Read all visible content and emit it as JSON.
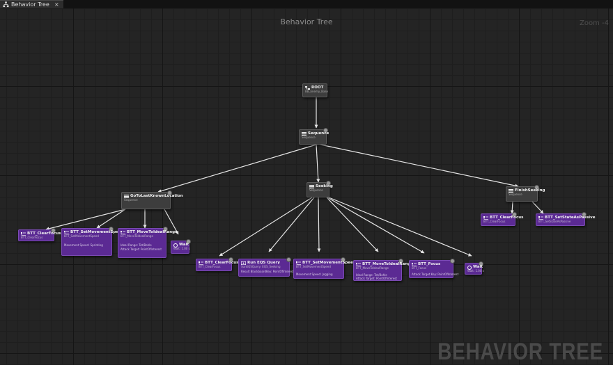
{
  "tab": {
    "label": "Behavior Tree",
    "close": "×"
  },
  "graph": {
    "title": "Behavior Tree",
    "zoom": "Zoom -4",
    "watermark": "BEHAVIOR TREE"
  },
  "nodes": {
    "root": {
      "title": "ROOT",
      "sub": "BB_Enemy_Base"
    },
    "seq": {
      "title": "Sequence",
      "sub": "Sequence"
    },
    "goto": {
      "title": "GoToLastKnownLocation",
      "sub": "Sequence"
    },
    "seeking": {
      "title": "Seeking",
      "sub": "Sequence"
    },
    "finish": {
      "title": "FinishSeeking",
      "sub": "Sequence"
    },
    "g_clear": {
      "title": "BTT_ClearFocus",
      "sub": "BTT_ClearFocus"
    },
    "g_speed": {
      "title": "BTT_SetMovementSpeed",
      "sub": "BTT_SetMovementSpeed",
      "p1": "Movement Speed: Sprinting"
    },
    "g_move": {
      "title": "BTT_MoveToIdealRange",
      "sub": "BTT_MoveToIdealRange",
      "p1": "Ideal Range: Tet/Bohle",
      "p2": "Attack Target: PointOfInterest"
    },
    "g_wait": {
      "title": "Wait",
      "sub": "Wait: 1.00 s"
    },
    "s_clear": {
      "title": "BTT_ClearFocus",
      "sub": "BTT_ClearFocus"
    },
    "s_eqs": {
      "title": "Run EQS Query",
      "sub": "SunEQSQuery: EQS_Seeking",
      "p1": "Result BlackboardKey: PointOfInterest"
    },
    "s_speed": {
      "title": "BTT_SetMovementSpeed",
      "sub": "BTT_SetMovementSpeed",
      "p1": "Movement Speed: Jogging"
    },
    "s_move": {
      "title": "BTT_MoveToIdealRange",
      "sub": "BTT_MoveToIdealRange",
      "p1": "Ideal Range: Tet/Bohle",
      "p2": "Attack Target: PointOfInterest"
    },
    "s_focus": {
      "title": "BTT_Focus",
      "sub": "BTT_Focus",
      "p1": "Attack Target Key: PointOfInterest"
    },
    "s_wait": {
      "title": "Wait",
      "sub": "Wait: 1.00 s"
    },
    "f_clear": {
      "title": "BTT_ClearFocus",
      "sub": "BTT_ClearFocus"
    },
    "f_passive": {
      "title": "BTT_SetStateAsPassive",
      "sub": "BTT_SetStateAsPassive"
    }
  },
  "colors": {
    "canvas": "#242424",
    "composite": "#3d3d3d",
    "task": "#5b2a93",
    "wire": "#e6e6e6"
  },
  "icons": {
    "tab": "behavior-tree-icon",
    "composite": "sequence-icon",
    "task": "task-icon",
    "wait": "wait-icon"
  }
}
